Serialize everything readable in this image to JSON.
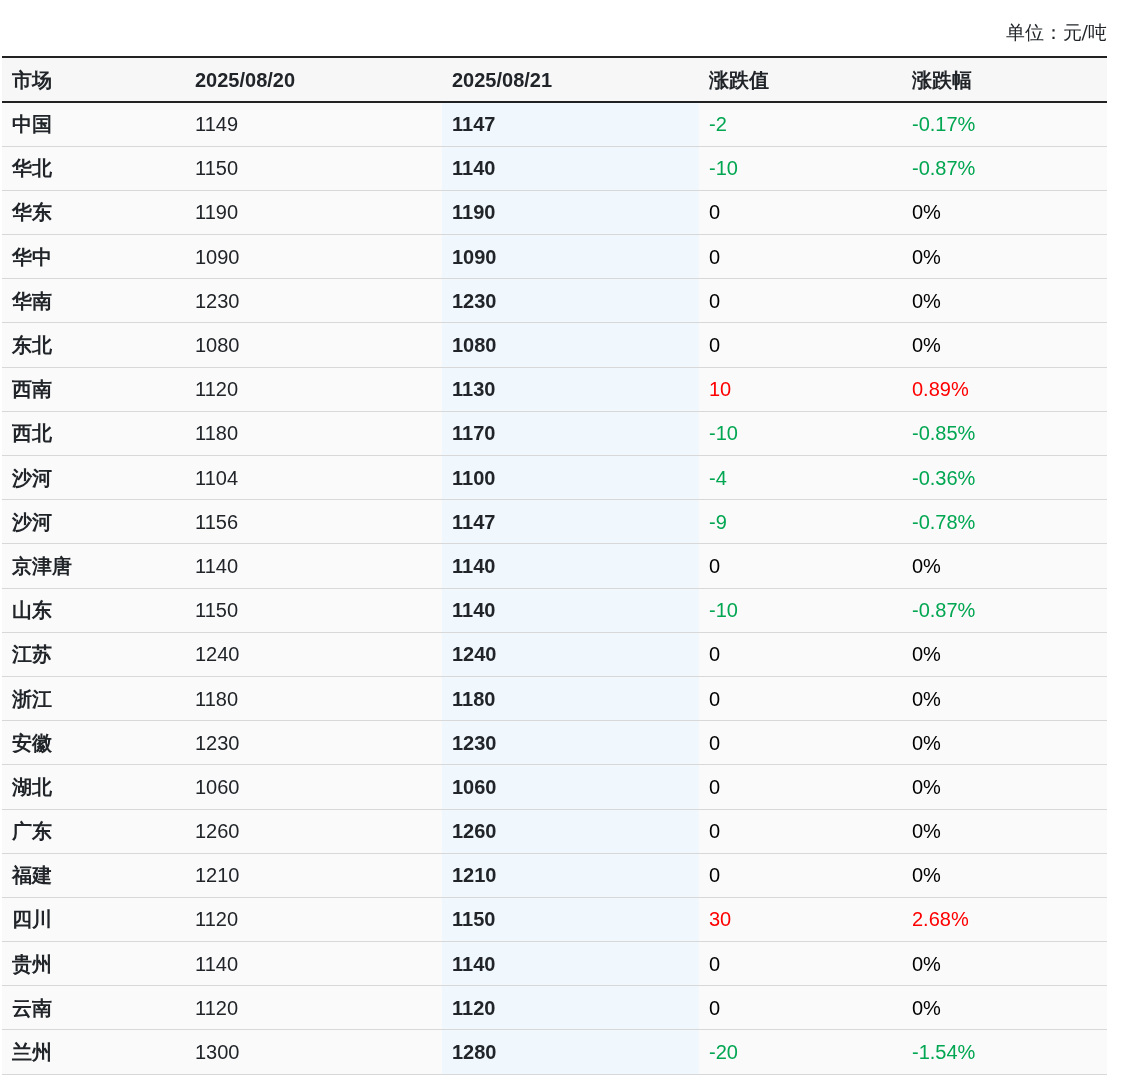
{
  "unit": "单位：元/吨",
  "columns": [
    "市场",
    "2025/08/20",
    "2025/08/21",
    "涨跌值",
    "涨跌幅"
  ],
  "rows": [
    {
      "market": "中国",
      "prev": "1149",
      "curr": "1147",
      "change": "-2",
      "pct": "-0.17%",
      "kind": "down"
    },
    {
      "market": "华北",
      "prev": "1150",
      "curr": "1140",
      "change": "-10",
      "pct": "-0.87%",
      "kind": "down"
    },
    {
      "market": "华东",
      "prev": "1190",
      "curr": "1190",
      "change": "0",
      "pct": "0%",
      "kind": "flat"
    },
    {
      "market": "华中",
      "prev": "1090",
      "curr": "1090",
      "change": "0",
      "pct": "0%",
      "kind": "flat"
    },
    {
      "market": "华南",
      "prev": "1230",
      "curr": "1230",
      "change": "0",
      "pct": "0%",
      "kind": "flat"
    },
    {
      "market": "东北",
      "prev": "1080",
      "curr": "1080",
      "change": "0",
      "pct": "0%",
      "kind": "flat"
    },
    {
      "market": "西南",
      "prev": "1120",
      "curr": "1130",
      "change": "10",
      "pct": "0.89%",
      "kind": "up"
    },
    {
      "market": "西北",
      "prev": "1180",
      "curr": "1170",
      "change": "-10",
      "pct": "-0.85%",
      "kind": "down"
    },
    {
      "market": "沙河",
      "prev": "1104",
      "curr": "1100",
      "change": "-4",
      "pct": "-0.36%",
      "kind": "down"
    },
    {
      "market": "沙河",
      "prev": "1156",
      "curr": "1147",
      "change": "-9",
      "pct": "-0.78%",
      "kind": "down"
    },
    {
      "market": "京津唐",
      "prev": "1140",
      "curr": "1140",
      "change": "0",
      "pct": "0%",
      "kind": "flat"
    },
    {
      "market": "山东",
      "prev": "1150",
      "curr": "1140",
      "change": "-10",
      "pct": "-0.87%",
      "kind": "down"
    },
    {
      "market": "江苏",
      "prev": "1240",
      "curr": "1240",
      "change": "0",
      "pct": "0%",
      "kind": "flat"
    },
    {
      "market": "浙江",
      "prev": "1180",
      "curr": "1180",
      "change": "0",
      "pct": "0%",
      "kind": "flat"
    },
    {
      "market": "安徽",
      "prev": "1230",
      "curr": "1230",
      "change": "0",
      "pct": "0%",
      "kind": "flat"
    },
    {
      "market": "湖北",
      "prev": "1060",
      "curr": "1060",
      "change": "0",
      "pct": "0%",
      "kind": "flat"
    },
    {
      "market": "广东",
      "prev": "1260",
      "curr": "1260",
      "change": "0",
      "pct": "0%",
      "kind": "flat"
    },
    {
      "market": "福建",
      "prev": "1210",
      "curr": "1210",
      "change": "0",
      "pct": "0%",
      "kind": "flat"
    },
    {
      "market": "四川",
      "prev": "1120",
      "curr": "1150",
      "change": "30",
      "pct": "2.68%",
      "kind": "up"
    },
    {
      "market": "贵州",
      "prev": "1140",
      "curr": "1140",
      "change": "0",
      "pct": "0%",
      "kind": "flat"
    },
    {
      "market": "云南",
      "prev": "1120",
      "curr": "1120",
      "change": "0",
      "pct": "0%",
      "kind": "flat"
    },
    {
      "market": "兰州",
      "prev": "1300",
      "curr": "1280",
      "change": "-20",
      "pct": "-1.54%",
      "kind": "down"
    }
  ]
}
